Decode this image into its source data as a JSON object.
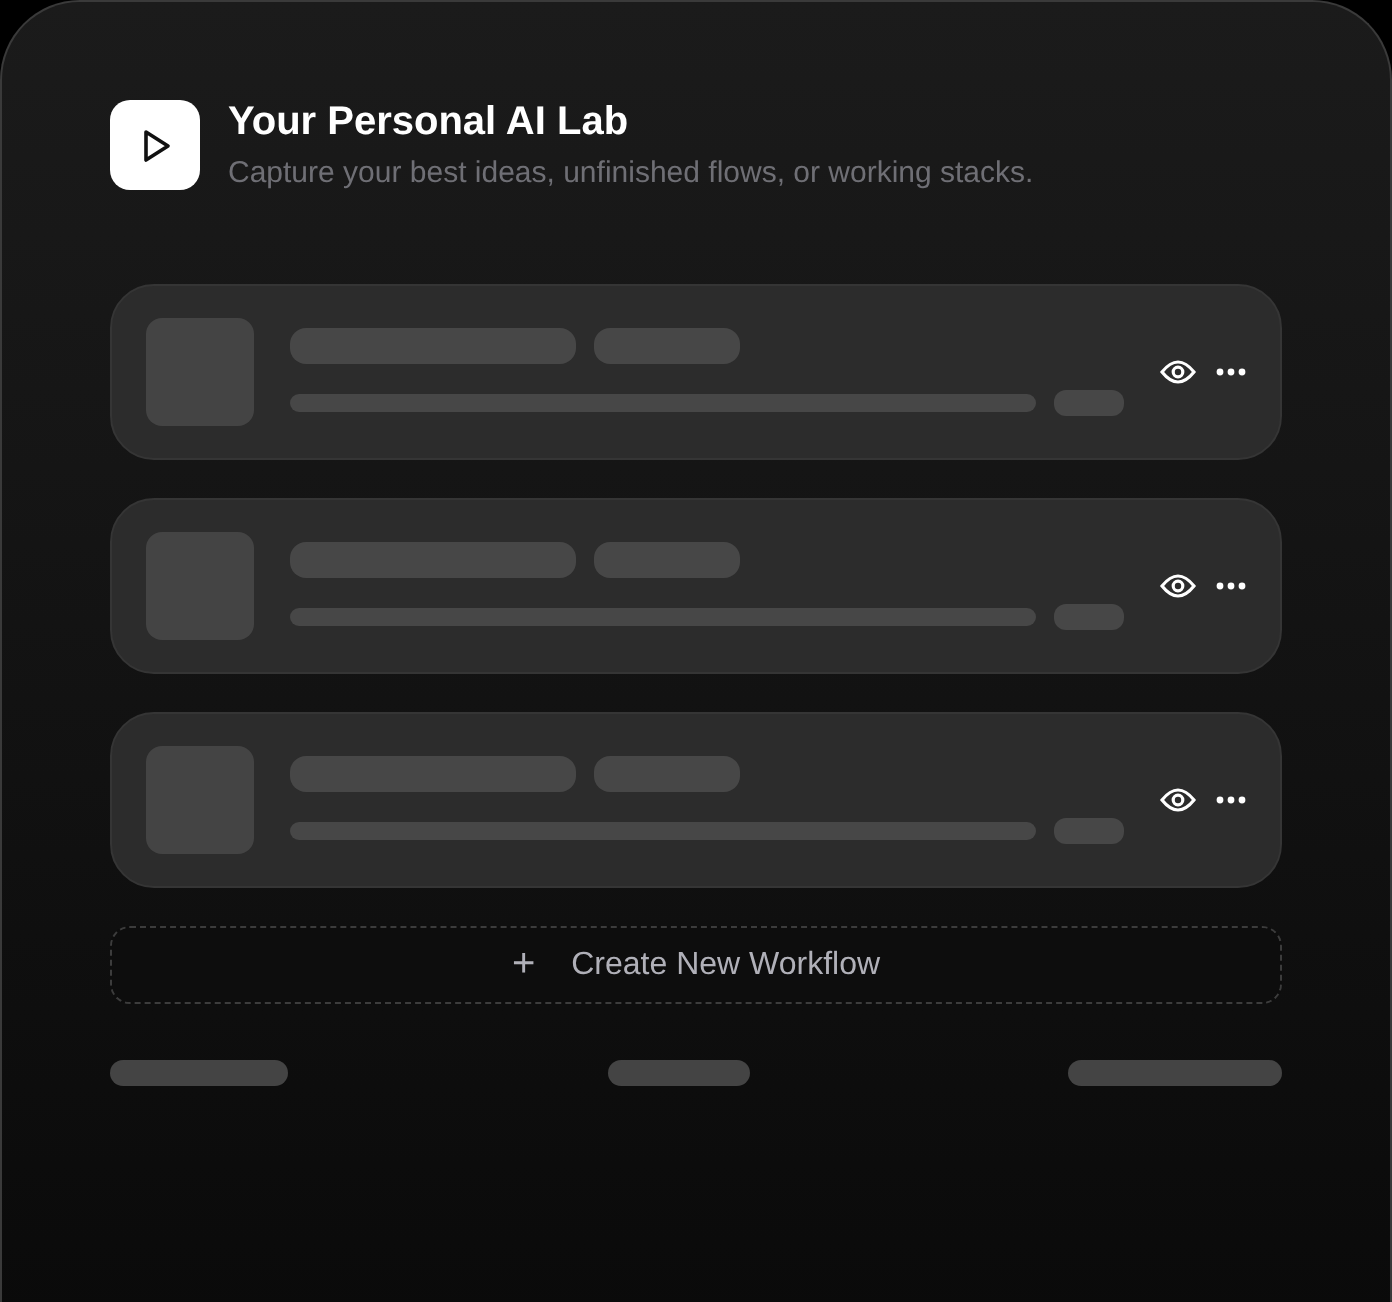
{
  "header": {
    "title": "Your Personal AI Lab",
    "subtitle": "Capture your best ideas, unfinished flows, or working stacks."
  },
  "workflows": [
    {
      "kind": "skeleton"
    },
    {
      "kind": "skeleton"
    },
    {
      "kind": "skeleton"
    }
  ],
  "create_button": {
    "icon": "+",
    "label": "Create New Workflow"
  },
  "footer": [
    {
      "kind": "skeleton"
    },
    {
      "kind": "skeleton"
    },
    {
      "kind": "skeleton"
    }
  ]
}
